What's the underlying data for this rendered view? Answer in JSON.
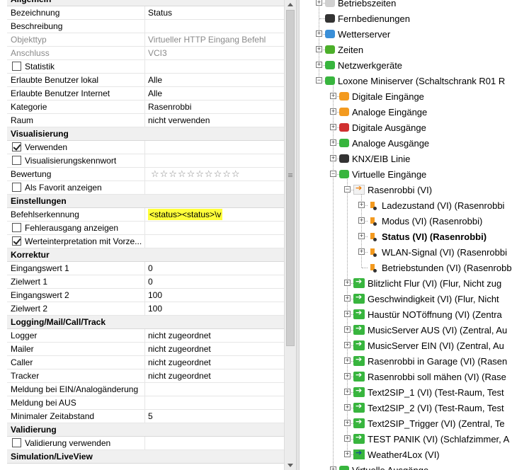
{
  "properties": {
    "sections": [
      {
        "title": "Allgemein",
        "rows": [
          {
            "key": "Bezeichnung",
            "value": "Status"
          },
          {
            "key": "Beschreibung",
            "value": ""
          },
          {
            "key": "Objekttyp",
            "value": "Virtueller HTTP Eingang Befehl",
            "readonly": true
          },
          {
            "key": "Anschluss",
            "value": "VCI3",
            "readonly": true
          },
          {
            "key": "Statistik",
            "value": "",
            "checkbox": true,
            "checked": false
          },
          {
            "key": "Erlaubte Benutzer lokal",
            "value": "Alle"
          },
          {
            "key": "Erlaubte Benutzer Internet",
            "value": "Alle"
          },
          {
            "key": "Kategorie",
            "value": "Rasenrobbi"
          },
          {
            "key": "Raum",
            "value": "nicht verwenden"
          }
        ]
      },
      {
        "title": "Visualisierung",
        "rows": [
          {
            "key": "Verwenden",
            "value": "",
            "checkbox": true,
            "checked": true
          },
          {
            "key": "Visualisierungskennwort",
            "value": "",
            "checkbox": true,
            "checked": false
          },
          {
            "key": "Bewertung",
            "value": "",
            "rating": 10
          },
          {
            "key": "Als Favorit anzeigen",
            "value": "",
            "checkbox": true,
            "checked": false
          }
        ]
      },
      {
        "title": "Einstellungen",
        "rows": [
          {
            "key": "Befehlserkennung",
            "value": "<status><status>\\v",
            "highlight": true
          },
          {
            "key": "Fehlerausgang anzeigen",
            "value": "",
            "checkbox": true,
            "checked": false
          },
          {
            "key": "Werteinterpretation mit Vorze...",
            "value": "",
            "checkbox": true,
            "checked": true
          }
        ]
      },
      {
        "title": "Korrektur",
        "rows": [
          {
            "key": "Eingangswert 1",
            "value": "0"
          },
          {
            "key": "Zielwert 1",
            "value": "0"
          },
          {
            "key": "Eingangswert 2",
            "value": "100"
          },
          {
            "key": "Zielwert 2",
            "value": "100"
          }
        ]
      },
      {
        "title": "Logging/Mail/Call/Track",
        "rows": [
          {
            "key": "Logger",
            "value": "nicht zugeordnet"
          },
          {
            "key": "Mailer",
            "value": "nicht zugeordnet"
          },
          {
            "key": "Caller",
            "value": "nicht zugeordnet"
          },
          {
            "key": "Tracker",
            "value": "nicht zugeordnet"
          },
          {
            "key": "Meldung bei EIN/Analogänderung",
            "value": ""
          },
          {
            "key": "Meldung bei AUS",
            "value": ""
          },
          {
            "key": "Minimaler Zeitabstand",
            "value": "5"
          }
        ]
      },
      {
        "title": "Validierung",
        "rows": [
          {
            "key": "Validierung verwenden",
            "value": "",
            "checkbox": true,
            "checked": false
          }
        ]
      },
      {
        "title": "Simulation/LiveView",
        "rows": []
      }
    ]
  },
  "tree": {
    "nodes": [
      {
        "label": "Betriebszeiten",
        "level": 0,
        "expander": "+",
        "icon": "clock-list-icon",
        "color": "#d0d0d0"
      },
      {
        "label": "Fernbedienungen",
        "level": 0,
        "expander": "",
        "icon": "remote-icon",
        "color": "#333333"
      },
      {
        "label": "Wetterserver",
        "level": 0,
        "expander": "+",
        "icon": "weather-icon",
        "color": "#3a8fd8"
      },
      {
        "label": "Zeiten",
        "level": 0,
        "expander": "+",
        "icon": "clock-icon",
        "color": "#4caf2a"
      },
      {
        "label": "Netzwerkgeräte",
        "level": 0,
        "expander": "+",
        "icon": "network-icon",
        "color": "#38b53e"
      },
      {
        "label": "Loxone Miniserver (Schaltschrank R01 R",
        "level": 0,
        "expander": "−",
        "icon": "miniserver-icon",
        "color": "#38b53e"
      },
      {
        "label": "Digitale Eingänge",
        "level": 1,
        "expander": "+",
        "icon": "digital-input-icon",
        "color": "#f39a1f"
      },
      {
        "label": "Analoge Eingänge",
        "level": 1,
        "expander": "+",
        "icon": "analog-input-icon",
        "color": "#f39a1f"
      },
      {
        "label": "Digitale Ausgänge",
        "level": 1,
        "expander": "+",
        "icon": "digital-output-icon",
        "color": "#d03030"
      },
      {
        "label": "Analoge Ausgänge",
        "level": 1,
        "expander": "+",
        "icon": "analog-output-icon",
        "color": "#38b53e"
      },
      {
        "label": "KNX/EIB Linie",
        "level": 1,
        "expander": "+",
        "icon": "knx-icon",
        "color": "#333333"
      },
      {
        "label": "Virtuelle Eingänge",
        "level": 1,
        "expander": "−",
        "icon": "virtual-input-icon",
        "color": "#38b53e"
      },
      {
        "label": "Rasenrobbi (VI)",
        "level": 2,
        "expander": "−",
        "icon": "virtual-http-input-icon",
        "color": "#f07c00"
      },
      {
        "label": "Ladezustand (VI) (Rasenrobbi",
        "level": 3,
        "expander": "+",
        "icon": "command-icon"
      },
      {
        "label": "Modus (VI) (Rasenrobbi)",
        "level": 3,
        "expander": "+",
        "icon": "command-icon"
      },
      {
        "label": "Status (VI) (Rasenrobbi)",
        "level": 3,
        "expander": "+",
        "icon": "command-icon",
        "selected": true
      },
      {
        "label": "WLAN-Signal (VI) (Rasenrobbi",
        "level": 3,
        "expander": "+",
        "icon": "command-icon"
      },
      {
        "label": "Betriebstunden (VI) (Rasenrobbi",
        "level": 3,
        "expander": "",
        "icon": "command-icon"
      },
      {
        "label": "Blitzlicht Flur (VI) (Flur, Nicht zug",
        "level": 2,
        "expander": "+",
        "icon": "virtual-input-icon"
      },
      {
        "label": "Geschwindigkeit (VI) (Flur, Nicht",
        "level": 2,
        "expander": "+",
        "icon": "virtual-input-icon"
      },
      {
        "label": "Haustür NOTöffnung (VI) (Zentra",
        "level": 2,
        "expander": "+",
        "icon": "virtual-input-icon"
      },
      {
        "label": "MusicServer AUS (VI) (Zentral, Au",
        "level": 2,
        "expander": "+",
        "icon": "virtual-input-icon"
      },
      {
        "label": "MusicServer EIN (VI) (Zentral, Au",
        "level": 2,
        "expander": "+",
        "icon": "virtual-input-icon"
      },
      {
        "label": "Rasenrobbi in Garage (VI) (Rasen",
        "level": 2,
        "expander": "+",
        "icon": "virtual-input-icon"
      },
      {
        "label": "Rasenrobbi soll mähen (VI) (Rase",
        "level": 2,
        "expander": "+",
        "icon": "virtual-input-icon"
      },
      {
        "label": "Text2SIP_1 (VI) (Test-Raum, Test",
        "level": 2,
        "expander": "+",
        "icon": "virtual-input-icon"
      },
      {
        "label": "Text2SIP_2 (VI) (Test-Raum, Test",
        "level": 2,
        "expander": "+",
        "icon": "virtual-input-icon"
      },
      {
        "label": "Text2SIP_Trigger (VI) (Zentral, Te",
        "level": 2,
        "expander": "+",
        "icon": "virtual-input-icon"
      },
      {
        "label": "TEST PANIK (VI) (Schlafzimmer, A",
        "level": 2,
        "expander": "+",
        "icon": "virtual-input-icon"
      },
      {
        "label": "Weather4Lox (VI)",
        "level": 2,
        "expander": "+",
        "icon": "virtual-input-blue-icon"
      },
      {
        "label": "Virtuelle Ausgänge",
        "level": 1,
        "expander": "+",
        "icon": "virtual-output-icon",
        "color": "#38b53e"
      }
    ]
  }
}
